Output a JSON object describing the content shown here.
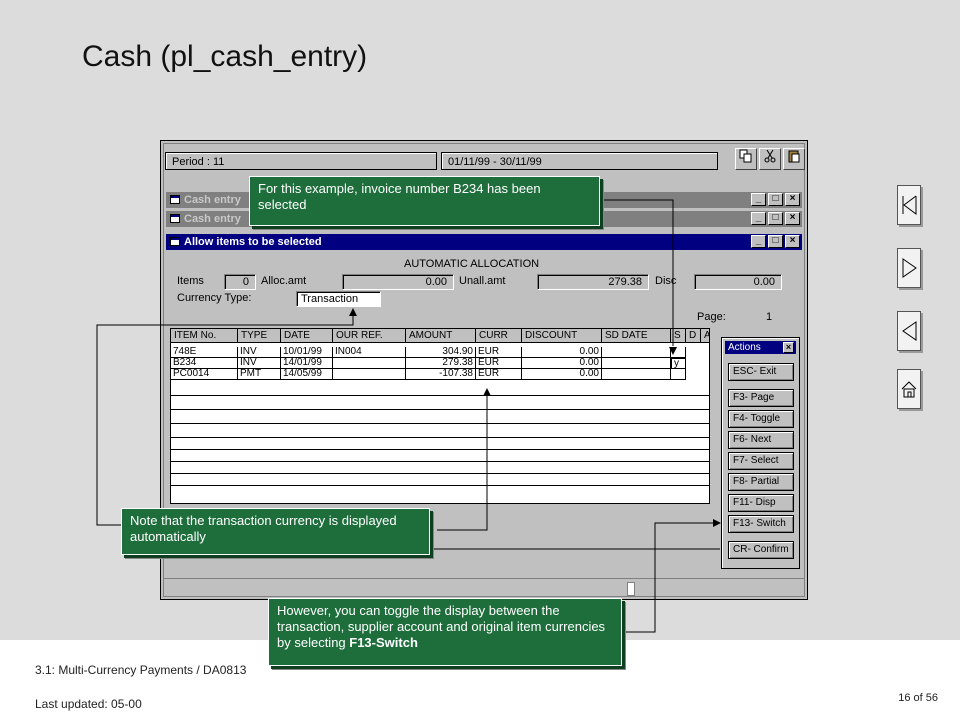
{
  "slide": {
    "title": "Cash (pl_cash_entry)",
    "footer_course": "3.1: Multi-Currency Payments / DA0813",
    "footer_updated": "Last updated:  05-00",
    "page_counter": "16 of 56"
  },
  "toolbar": {
    "period": "Period : 11",
    "date_range": "01/11/99 - 30/11/99",
    "icons": [
      "copy-icon",
      "cut-icon",
      "paste-icon"
    ]
  },
  "windows": [
    {
      "title": "Cash entry"
    },
    {
      "title": "Cash entry"
    },
    {
      "title": "Allow items to be selected"
    }
  ],
  "form": {
    "heading": "AUTOMATIC ALLOCATION",
    "items_label": "Items",
    "items_value": "0",
    "alloc_label": "Alloc.amt",
    "alloc_value": "0.00",
    "unall_label": "Unall.amt",
    "unall_value": "279.38",
    "disc_label": "Disc",
    "disc_value": "0.00",
    "currency_type_label": "Currency Type:",
    "currency_type_value": "Transaction",
    "page_label": "Page:",
    "page_value": "1"
  },
  "grid": {
    "columns": [
      "ITEM No.",
      "TYPE",
      "DATE",
      "OUR REF.",
      "AMOUNT",
      "CURR",
      "DISCOUNT",
      "SD DATE",
      "S",
      "D",
      "A"
    ],
    "rows": [
      [
        "748E",
        "INV",
        "10/01/99",
        "IN004",
        "304.90",
        "EUR",
        "0.00",
        "",
        "",
        "",
        ""
      ],
      [
        "B234",
        "INV",
        "14/01/99",
        "",
        "279.38",
        "EUR",
        "0.00",
        "",
        "y",
        "",
        ""
      ],
      [
        "PC0014",
        "PMT",
        "14/05/99",
        "",
        "-107.38",
        "EUR",
        "0.00",
        "",
        "",
        "",
        ""
      ]
    ]
  },
  "actions": {
    "title": "Actions",
    "buttons": [
      "ESC- Exit",
      "F3- Page",
      "F4- Toggle",
      "F6- Next",
      "F7- Select",
      "F8- Partial",
      "F11- Disp",
      "F13- Switch",
      "CR- Confirm"
    ]
  },
  "callouts": {
    "invoice": "For this example, invoice number B234 has been selected",
    "currency": "Note that the transaction currency is displayed automatically",
    "toggle_prefix": "However, you can toggle the display between the transaction, supplier account and original item currencies by selecting ",
    "toggle_key": "F13-Switch"
  },
  "nav": [
    "first-page-icon",
    "next-page-icon",
    "previous-page-icon",
    "home-icon"
  ],
  "colors": {
    "callout_green": "#1e6e3c",
    "titlebar_active": "#000080",
    "window_gray": "#c0c0c0"
  }
}
